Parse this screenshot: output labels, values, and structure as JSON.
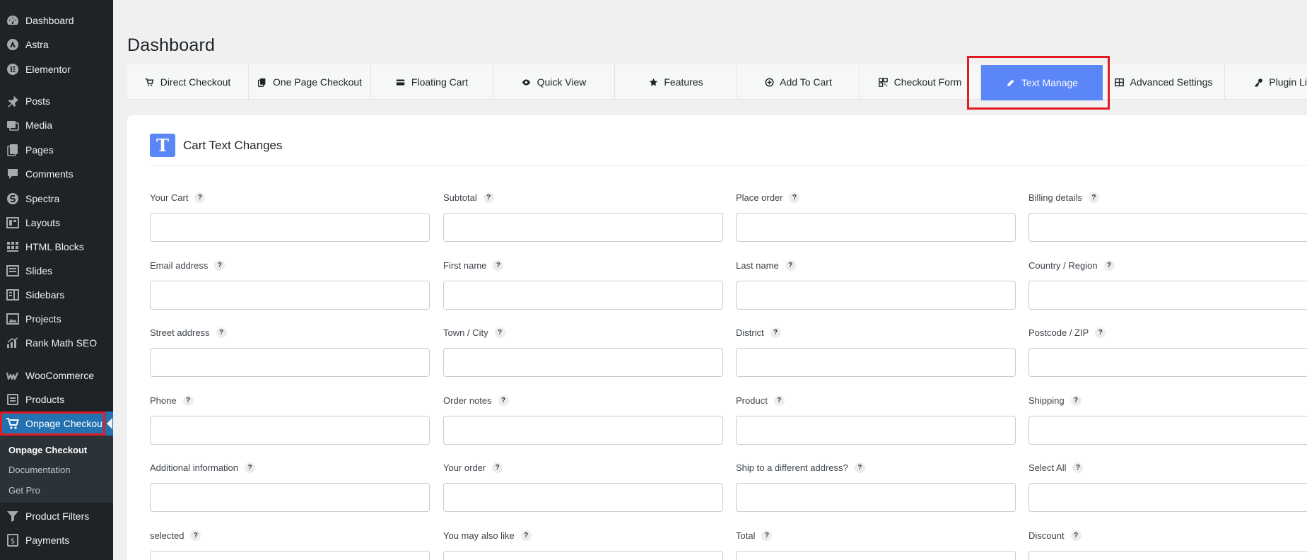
{
  "sidebar": {
    "items": [
      {
        "label": "Dashboard",
        "icon": "dashboard-icon"
      },
      {
        "label": "Astra",
        "icon": "astra-icon"
      },
      {
        "label": "Elementor",
        "icon": "elementor-icon"
      },
      {
        "label": "Posts",
        "icon": "pin-icon"
      },
      {
        "label": "Media",
        "icon": "media-icon"
      },
      {
        "label": "Pages",
        "icon": "pages-icon"
      },
      {
        "label": "Comments",
        "icon": "comments-icon"
      },
      {
        "label": "Spectra",
        "icon": "spectra-icon"
      },
      {
        "label": "Layouts",
        "icon": "layouts-icon"
      },
      {
        "label": "HTML Blocks",
        "icon": "grid-icon"
      },
      {
        "label": "Slides",
        "icon": "slides-icon"
      },
      {
        "label": "Sidebars",
        "icon": "sidebars-icon"
      },
      {
        "label": "Projects",
        "icon": "projects-icon"
      },
      {
        "label": "Rank Math SEO",
        "icon": "rankmath-icon"
      },
      {
        "label": "WooCommerce",
        "icon": "woocommerce-icon"
      },
      {
        "label": "Products",
        "icon": "products-icon"
      },
      {
        "label": "Onpage Checkout",
        "icon": "cart-icon"
      },
      {
        "label": "Product Filters",
        "icon": "filter-icon"
      },
      {
        "label": "Payments",
        "icon": "payments-icon"
      }
    ],
    "submenu": [
      "Onpage Checkout",
      "Documentation",
      "Get Pro"
    ]
  },
  "page": {
    "title": "Dashboard"
  },
  "tabs": [
    {
      "label": "Direct Checkout",
      "icon": "cart-icon"
    },
    {
      "label": "One Page Checkout",
      "icon": "copy-icon"
    },
    {
      "label": "Floating Cart",
      "icon": "card-icon"
    },
    {
      "label": "Quick View",
      "icon": "eye-icon"
    },
    {
      "label": "Features",
      "icon": "star-icon"
    },
    {
      "label": "Add To Cart",
      "icon": "plus-circle-icon"
    },
    {
      "label": "Checkout Form",
      "icon": "qr-icon"
    },
    {
      "label": "Text Manage",
      "icon": "pencil-icon"
    },
    {
      "label": "Advanced Settings",
      "icon": "table-icon"
    },
    {
      "label": "Plugin Lice",
      "icon": "key-icon"
    }
  ],
  "panel": {
    "badge": "T",
    "title": "Cart Text Changes",
    "help_glyph": "?",
    "fields": [
      "Your Cart",
      "Subtotal",
      "Place order",
      "Billing details",
      "Email address",
      "First name",
      "Last name",
      "Country / Region",
      "Street address",
      "Town / City",
      "District",
      "Postcode / ZIP",
      "Phone",
      "Order notes",
      "Product",
      "Shipping",
      "Additional information",
      "Your order",
      "Ship to a different address?",
      "Select All",
      "selected",
      "You may also like",
      "Total",
      "Discount"
    ]
  },
  "colors": {
    "accent": "#5b86f7",
    "highlight": "#e21b23",
    "sidebar": "#1d2327",
    "wp_blue": "#2271b1"
  }
}
